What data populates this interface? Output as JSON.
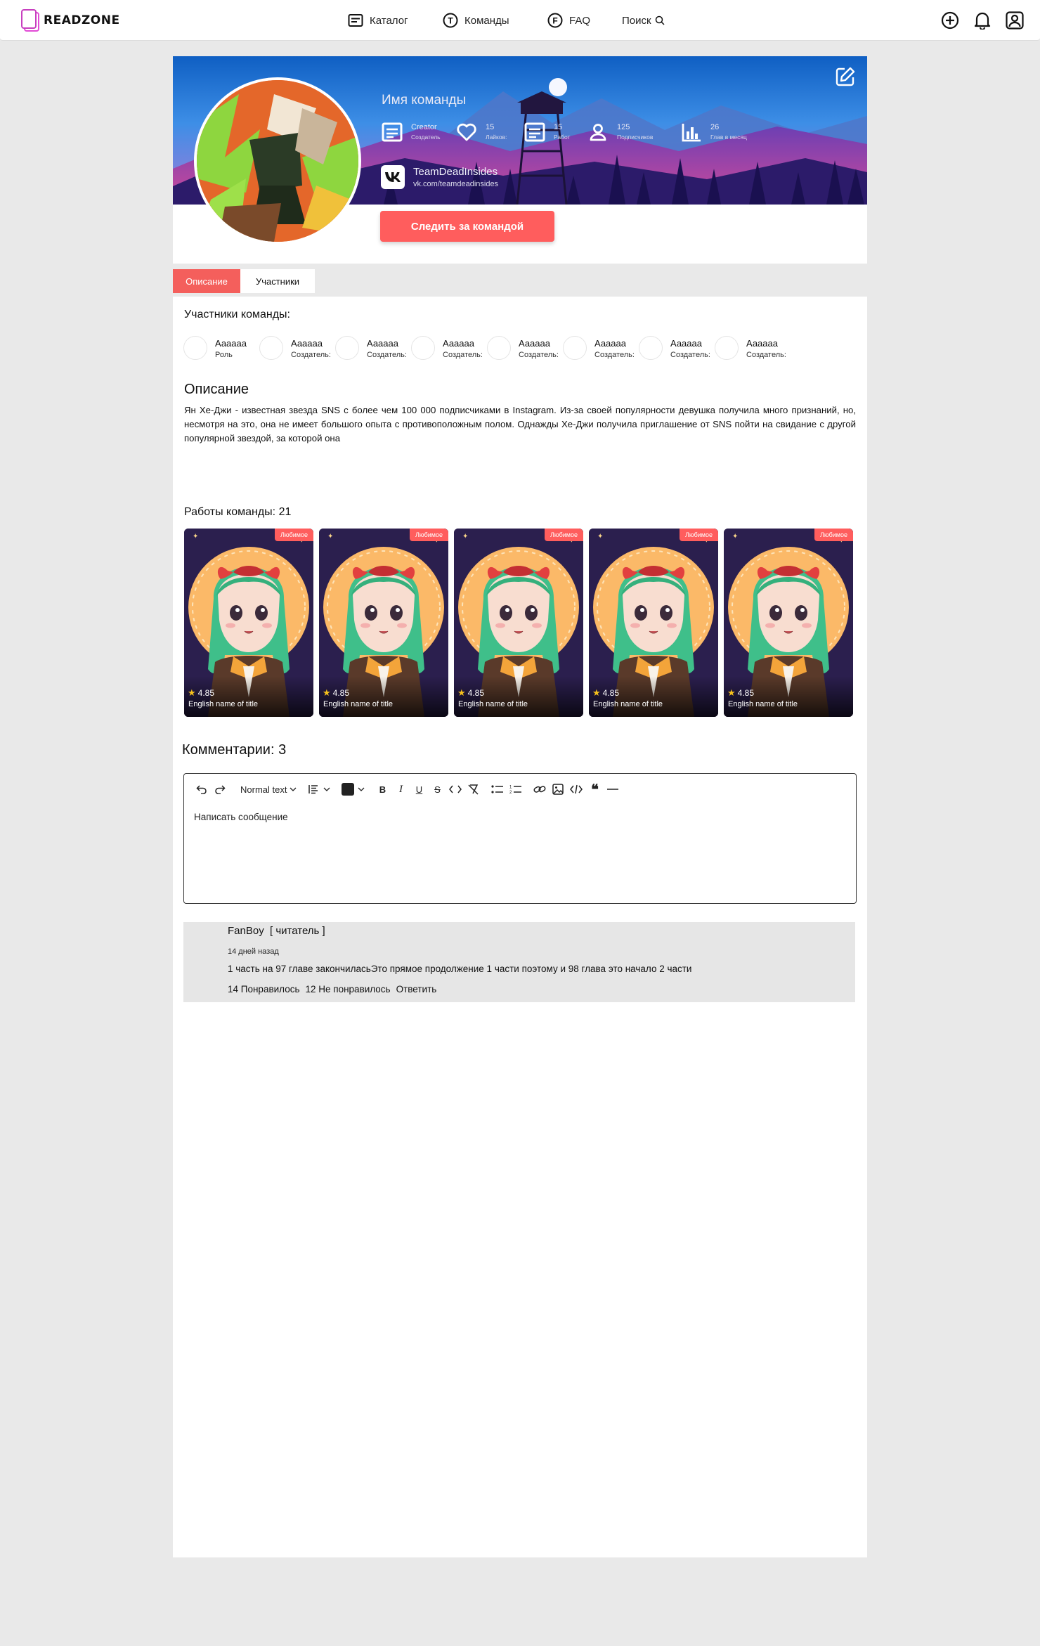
{
  "brand": {
    "name": "READZONE"
  },
  "nav": {
    "catalog": "Каталог",
    "teams": "Команды",
    "faq": "FAQ",
    "search": "Поиск",
    "teams_icon_letter": "T",
    "faq_icon_letter": "F"
  },
  "team": {
    "name": "Имя команды",
    "stats": [
      {
        "value": "Creator",
        "label": "Создатель",
        "icon": "document-icon"
      },
      {
        "value": "15",
        "label": "Лайков:",
        "icon": "heart-icon"
      },
      {
        "value": "15",
        "label": "Работ",
        "icon": "document-icon"
      },
      {
        "value": "125",
        "label": "Подписчиков",
        "icon": "user-icon"
      },
      {
        "value": "26",
        "label": "Глав в месяц",
        "icon": "bar-chart-icon"
      }
    ],
    "social": {
      "name": "TeamDeadInsides",
      "link": "vk.com/teamdeadinsides",
      "icon": "vk-icon"
    },
    "follow_label": "Следить за командой"
  },
  "tabs": [
    "Описание",
    "Участники"
  ],
  "members": {
    "title": "Участники команды:",
    "items": [
      {
        "name": "Аааааа",
        "role": "Роль"
      },
      {
        "name": "Аааааа",
        "role": "Создатель:"
      },
      {
        "name": "Аааааа",
        "role": "Создатель:"
      },
      {
        "name": "Аааааа",
        "role": "Создатель:"
      },
      {
        "name": "Аааааа",
        "role": "Создатель:"
      },
      {
        "name": "Аааааа",
        "role": "Создатель:"
      },
      {
        "name": "Аааааа",
        "role": "Создатель:"
      },
      {
        "name": "Аааааа",
        "role": "Создатель:"
      }
    ]
  },
  "description": {
    "title": "Описание",
    "text": "Ян Хе-Джи - известная звезда SNS с более чем 100 000 подписчиками в Instagram. Из-за своей популярности девушка получила много признаний, но, несмотря на это, она не имеет большого опыта с противоположным полом. Однажды Хе-Джи получила приглашение от SNS пойти на свидание с другой популярной звездой, за которой она"
  },
  "works": {
    "title": "Работы команды: 21",
    "items": [
      {
        "badge": "Любимое",
        "rating": "4.85",
        "title": "English name of title"
      },
      {
        "badge": "Любимое",
        "rating": "4.85",
        "title": "English name of title"
      },
      {
        "badge": "Любимое",
        "rating": "4.85",
        "title": "English name of title"
      },
      {
        "badge": "Любимое",
        "rating": "4.85",
        "title": "English name of title"
      },
      {
        "badge": "Любимое",
        "rating": "4.85",
        "title": "English name of title"
      }
    ]
  },
  "comments": {
    "title": "Комментарии: 3",
    "editor": {
      "text_style": "Normal text",
      "placeholder": "Написать сообщение",
      "text_color": "#222222"
    },
    "items": [
      {
        "author": "FanBoy",
        "role": "[ читатель ]",
        "time": "14 дней назад",
        "text": "1 часть на 97 главе закончиласьЭто прямое продолжение 1 части поэтому и 98 глава это начало 2 части",
        "likes": "14 Понравилось",
        "dislikes": "12 Не понравилось",
        "reply": "Ответить"
      }
    ]
  },
  "colors": {
    "accent": "#ff5d5d",
    "tab_active": "#f45f5c",
    "page_bg": "#e9e9e9",
    "brand": "#d543c9"
  }
}
